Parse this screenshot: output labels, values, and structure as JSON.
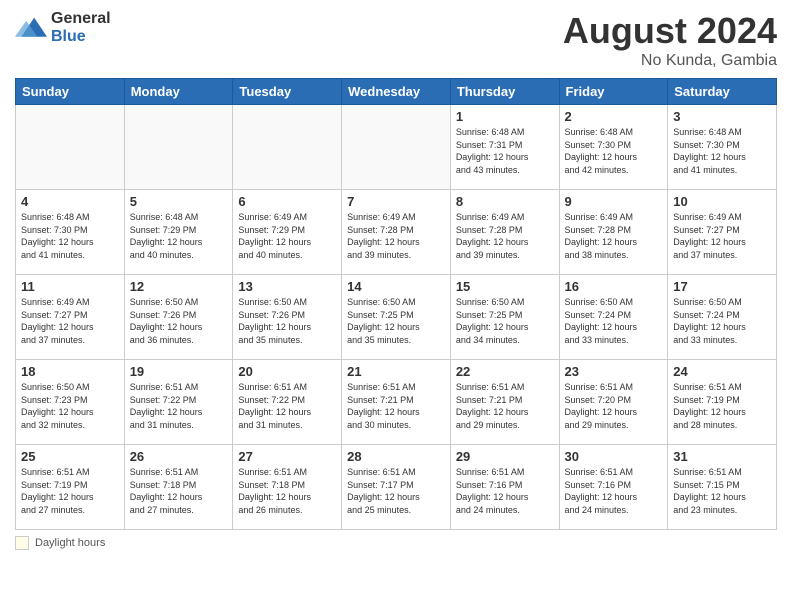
{
  "header": {
    "logo_general": "General",
    "logo_blue": "Blue",
    "title": "August 2024",
    "subtitle": "No Kunda, Gambia"
  },
  "days_of_week": [
    "Sunday",
    "Monday",
    "Tuesday",
    "Wednesday",
    "Thursday",
    "Friday",
    "Saturday"
  ],
  "legend_label": "Daylight hours",
  "weeks": [
    [
      {
        "day": "",
        "info": ""
      },
      {
        "day": "",
        "info": ""
      },
      {
        "day": "",
        "info": ""
      },
      {
        "day": "",
        "info": ""
      },
      {
        "day": "1",
        "info": "Sunrise: 6:48 AM\nSunset: 7:31 PM\nDaylight: 12 hours\nand 43 minutes."
      },
      {
        "day": "2",
        "info": "Sunrise: 6:48 AM\nSunset: 7:30 PM\nDaylight: 12 hours\nand 42 minutes."
      },
      {
        "day": "3",
        "info": "Sunrise: 6:48 AM\nSunset: 7:30 PM\nDaylight: 12 hours\nand 41 minutes."
      }
    ],
    [
      {
        "day": "4",
        "info": "Sunrise: 6:48 AM\nSunset: 7:30 PM\nDaylight: 12 hours\nand 41 minutes."
      },
      {
        "day": "5",
        "info": "Sunrise: 6:48 AM\nSunset: 7:29 PM\nDaylight: 12 hours\nand 40 minutes."
      },
      {
        "day": "6",
        "info": "Sunrise: 6:49 AM\nSunset: 7:29 PM\nDaylight: 12 hours\nand 40 minutes."
      },
      {
        "day": "7",
        "info": "Sunrise: 6:49 AM\nSunset: 7:28 PM\nDaylight: 12 hours\nand 39 minutes."
      },
      {
        "day": "8",
        "info": "Sunrise: 6:49 AM\nSunset: 7:28 PM\nDaylight: 12 hours\nand 39 minutes."
      },
      {
        "day": "9",
        "info": "Sunrise: 6:49 AM\nSunset: 7:28 PM\nDaylight: 12 hours\nand 38 minutes."
      },
      {
        "day": "10",
        "info": "Sunrise: 6:49 AM\nSunset: 7:27 PM\nDaylight: 12 hours\nand 37 minutes."
      }
    ],
    [
      {
        "day": "11",
        "info": "Sunrise: 6:49 AM\nSunset: 7:27 PM\nDaylight: 12 hours\nand 37 minutes."
      },
      {
        "day": "12",
        "info": "Sunrise: 6:50 AM\nSunset: 7:26 PM\nDaylight: 12 hours\nand 36 minutes."
      },
      {
        "day": "13",
        "info": "Sunrise: 6:50 AM\nSunset: 7:26 PM\nDaylight: 12 hours\nand 35 minutes."
      },
      {
        "day": "14",
        "info": "Sunrise: 6:50 AM\nSunset: 7:25 PM\nDaylight: 12 hours\nand 35 minutes."
      },
      {
        "day": "15",
        "info": "Sunrise: 6:50 AM\nSunset: 7:25 PM\nDaylight: 12 hours\nand 34 minutes."
      },
      {
        "day": "16",
        "info": "Sunrise: 6:50 AM\nSunset: 7:24 PM\nDaylight: 12 hours\nand 33 minutes."
      },
      {
        "day": "17",
        "info": "Sunrise: 6:50 AM\nSunset: 7:24 PM\nDaylight: 12 hours\nand 33 minutes."
      }
    ],
    [
      {
        "day": "18",
        "info": "Sunrise: 6:50 AM\nSunset: 7:23 PM\nDaylight: 12 hours\nand 32 minutes."
      },
      {
        "day": "19",
        "info": "Sunrise: 6:51 AM\nSunset: 7:22 PM\nDaylight: 12 hours\nand 31 minutes."
      },
      {
        "day": "20",
        "info": "Sunrise: 6:51 AM\nSunset: 7:22 PM\nDaylight: 12 hours\nand 31 minutes."
      },
      {
        "day": "21",
        "info": "Sunrise: 6:51 AM\nSunset: 7:21 PM\nDaylight: 12 hours\nand 30 minutes."
      },
      {
        "day": "22",
        "info": "Sunrise: 6:51 AM\nSunset: 7:21 PM\nDaylight: 12 hours\nand 29 minutes."
      },
      {
        "day": "23",
        "info": "Sunrise: 6:51 AM\nSunset: 7:20 PM\nDaylight: 12 hours\nand 29 minutes."
      },
      {
        "day": "24",
        "info": "Sunrise: 6:51 AM\nSunset: 7:19 PM\nDaylight: 12 hours\nand 28 minutes."
      }
    ],
    [
      {
        "day": "25",
        "info": "Sunrise: 6:51 AM\nSunset: 7:19 PM\nDaylight: 12 hours\nand 27 minutes."
      },
      {
        "day": "26",
        "info": "Sunrise: 6:51 AM\nSunset: 7:18 PM\nDaylight: 12 hours\nand 27 minutes."
      },
      {
        "day": "27",
        "info": "Sunrise: 6:51 AM\nSunset: 7:18 PM\nDaylight: 12 hours\nand 26 minutes."
      },
      {
        "day": "28",
        "info": "Sunrise: 6:51 AM\nSunset: 7:17 PM\nDaylight: 12 hours\nand 25 minutes."
      },
      {
        "day": "29",
        "info": "Sunrise: 6:51 AM\nSunset: 7:16 PM\nDaylight: 12 hours\nand 24 minutes."
      },
      {
        "day": "30",
        "info": "Sunrise: 6:51 AM\nSunset: 7:16 PM\nDaylight: 12 hours\nand 24 minutes."
      },
      {
        "day": "31",
        "info": "Sunrise: 6:51 AM\nSunset: 7:15 PM\nDaylight: 12 hours\nand 23 minutes."
      }
    ]
  ]
}
